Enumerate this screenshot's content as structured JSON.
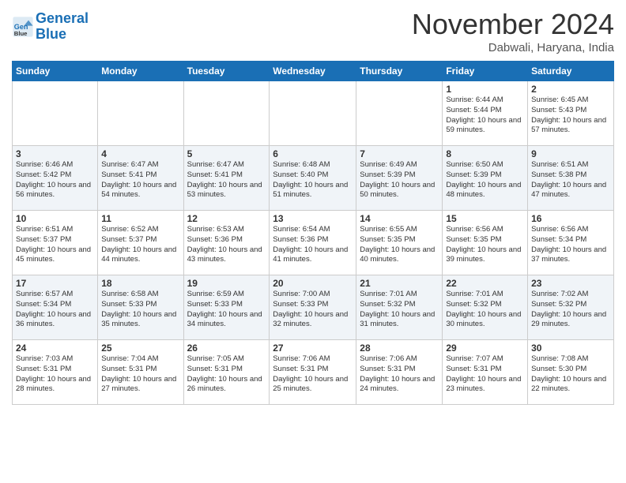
{
  "header": {
    "logo_line1": "General",
    "logo_line2": "Blue",
    "month": "November 2024",
    "location": "Dabwali, Haryana, India"
  },
  "weekdays": [
    "Sunday",
    "Monday",
    "Tuesday",
    "Wednesday",
    "Thursday",
    "Friday",
    "Saturday"
  ],
  "weeks": [
    [
      {
        "day": "",
        "info": ""
      },
      {
        "day": "",
        "info": ""
      },
      {
        "day": "",
        "info": ""
      },
      {
        "day": "",
        "info": ""
      },
      {
        "day": "",
        "info": ""
      },
      {
        "day": "1",
        "info": "Sunrise: 6:44 AM\nSunset: 5:44 PM\nDaylight: 10 hours and 59 minutes."
      },
      {
        "day": "2",
        "info": "Sunrise: 6:45 AM\nSunset: 5:43 PM\nDaylight: 10 hours and 57 minutes."
      }
    ],
    [
      {
        "day": "3",
        "info": "Sunrise: 6:46 AM\nSunset: 5:42 PM\nDaylight: 10 hours and 56 minutes."
      },
      {
        "day": "4",
        "info": "Sunrise: 6:47 AM\nSunset: 5:41 PM\nDaylight: 10 hours and 54 minutes."
      },
      {
        "day": "5",
        "info": "Sunrise: 6:47 AM\nSunset: 5:41 PM\nDaylight: 10 hours and 53 minutes."
      },
      {
        "day": "6",
        "info": "Sunrise: 6:48 AM\nSunset: 5:40 PM\nDaylight: 10 hours and 51 minutes."
      },
      {
        "day": "7",
        "info": "Sunrise: 6:49 AM\nSunset: 5:39 PM\nDaylight: 10 hours and 50 minutes."
      },
      {
        "day": "8",
        "info": "Sunrise: 6:50 AM\nSunset: 5:39 PM\nDaylight: 10 hours and 48 minutes."
      },
      {
        "day": "9",
        "info": "Sunrise: 6:51 AM\nSunset: 5:38 PM\nDaylight: 10 hours and 47 minutes."
      }
    ],
    [
      {
        "day": "10",
        "info": "Sunrise: 6:51 AM\nSunset: 5:37 PM\nDaylight: 10 hours and 45 minutes."
      },
      {
        "day": "11",
        "info": "Sunrise: 6:52 AM\nSunset: 5:37 PM\nDaylight: 10 hours and 44 minutes."
      },
      {
        "day": "12",
        "info": "Sunrise: 6:53 AM\nSunset: 5:36 PM\nDaylight: 10 hours and 43 minutes."
      },
      {
        "day": "13",
        "info": "Sunrise: 6:54 AM\nSunset: 5:36 PM\nDaylight: 10 hours and 41 minutes."
      },
      {
        "day": "14",
        "info": "Sunrise: 6:55 AM\nSunset: 5:35 PM\nDaylight: 10 hours and 40 minutes."
      },
      {
        "day": "15",
        "info": "Sunrise: 6:56 AM\nSunset: 5:35 PM\nDaylight: 10 hours and 39 minutes."
      },
      {
        "day": "16",
        "info": "Sunrise: 6:56 AM\nSunset: 5:34 PM\nDaylight: 10 hours and 37 minutes."
      }
    ],
    [
      {
        "day": "17",
        "info": "Sunrise: 6:57 AM\nSunset: 5:34 PM\nDaylight: 10 hours and 36 minutes."
      },
      {
        "day": "18",
        "info": "Sunrise: 6:58 AM\nSunset: 5:33 PM\nDaylight: 10 hours and 35 minutes."
      },
      {
        "day": "19",
        "info": "Sunrise: 6:59 AM\nSunset: 5:33 PM\nDaylight: 10 hours and 34 minutes."
      },
      {
        "day": "20",
        "info": "Sunrise: 7:00 AM\nSunset: 5:33 PM\nDaylight: 10 hours and 32 minutes."
      },
      {
        "day": "21",
        "info": "Sunrise: 7:01 AM\nSunset: 5:32 PM\nDaylight: 10 hours and 31 minutes."
      },
      {
        "day": "22",
        "info": "Sunrise: 7:01 AM\nSunset: 5:32 PM\nDaylight: 10 hours and 30 minutes."
      },
      {
        "day": "23",
        "info": "Sunrise: 7:02 AM\nSunset: 5:32 PM\nDaylight: 10 hours and 29 minutes."
      }
    ],
    [
      {
        "day": "24",
        "info": "Sunrise: 7:03 AM\nSunset: 5:31 PM\nDaylight: 10 hours and 28 minutes."
      },
      {
        "day": "25",
        "info": "Sunrise: 7:04 AM\nSunset: 5:31 PM\nDaylight: 10 hours and 27 minutes."
      },
      {
        "day": "26",
        "info": "Sunrise: 7:05 AM\nSunset: 5:31 PM\nDaylight: 10 hours and 26 minutes."
      },
      {
        "day": "27",
        "info": "Sunrise: 7:06 AM\nSunset: 5:31 PM\nDaylight: 10 hours and 25 minutes."
      },
      {
        "day": "28",
        "info": "Sunrise: 7:06 AM\nSunset: 5:31 PM\nDaylight: 10 hours and 24 minutes."
      },
      {
        "day": "29",
        "info": "Sunrise: 7:07 AM\nSunset: 5:31 PM\nDaylight: 10 hours and 23 minutes."
      },
      {
        "day": "30",
        "info": "Sunrise: 7:08 AM\nSunset: 5:30 PM\nDaylight: 10 hours and 22 minutes."
      }
    ]
  ]
}
